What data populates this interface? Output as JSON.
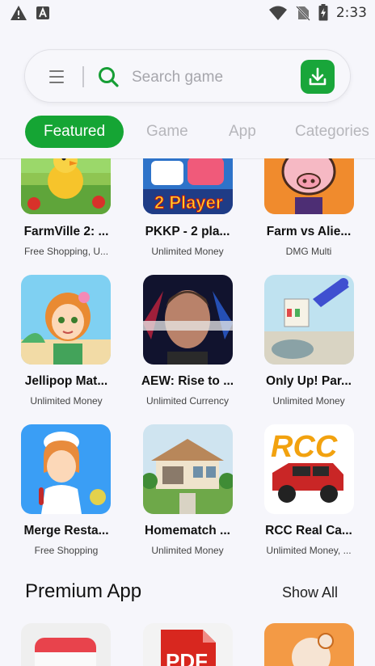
{
  "status_bar": {
    "time": "2:33",
    "icons": [
      "warning-icon",
      "a-notification-icon",
      "wifi-icon",
      "no-sim-icon",
      "battery-charging-icon"
    ]
  },
  "search": {
    "placeholder": "Search game",
    "icons": [
      "menu-icon",
      "search-icon",
      "download-icon"
    ],
    "accent": "#19a63a"
  },
  "tabs": [
    {
      "label": "Featured",
      "active": true
    },
    {
      "label": "Game",
      "active": false
    },
    {
      "label": "App",
      "active": false
    },
    {
      "label": "Categories",
      "active": false
    }
  ],
  "apps": [
    {
      "title": "FarmVille 2: ...",
      "subtitle": "Free Shopping, U..."
    },
    {
      "title": "PKKP - 2 pla...",
      "subtitle": "Unlimited Money",
      "logo_text": "2 Player"
    },
    {
      "title": "Farm vs Alie...",
      "subtitle": "DMG Multi"
    },
    {
      "title": "Jellipop Mat...",
      "subtitle": "Unlimited Money"
    },
    {
      "title": "AEW: Rise to ...",
      "subtitle": "Unlimited Currency"
    },
    {
      "title": "Only Up! Par...",
      "subtitle": "Unlimited Money"
    },
    {
      "title": "Merge Resta...",
      "subtitle": "Free Shopping"
    },
    {
      "title": "Homematch ...",
      "subtitle": "Unlimited Money"
    },
    {
      "title": "RCC Real Ca...",
      "subtitle": "Unlimited Money, ...",
      "logo_text": "RCC"
    }
  ],
  "premium": {
    "title": "Premium App",
    "show_all": "Show All",
    "items": [
      {
        "icon": "calendar-icon"
      },
      {
        "icon": "pdf-icon",
        "logo_text": "PDF"
      },
      {
        "icon": "orange-app-icon"
      }
    ]
  }
}
